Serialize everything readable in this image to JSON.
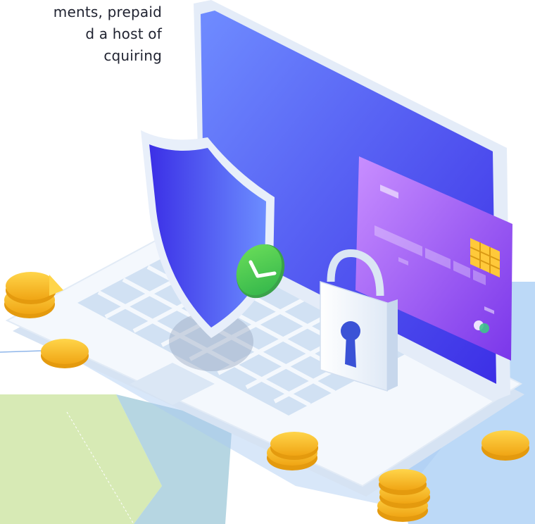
{
  "intro": {
    "text": "ments, prepaid\nd a host of\ncquiring"
  },
  "illustration": {
    "subject": "laptop-security-payment",
    "colors": {
      "screen": "#4c4ff0",
      "screen_light": "#6f8cff",
      "card": "#8f4ff2",
      "card_light": "#c48bff",
      "chip": "#ffc93a",
      "shield": "#3b3fe6",
      "check": "#43c94f",
      "coin": "#f5b81e",
      "coin_dark": "#e49a0e",
      "laptop_body": "#eef4fc",
      "key": "#dde9f8",
      "floor_blue": "#bcd9f7",
      "floor_green": "#cfe6a9"
    }
  }
}
